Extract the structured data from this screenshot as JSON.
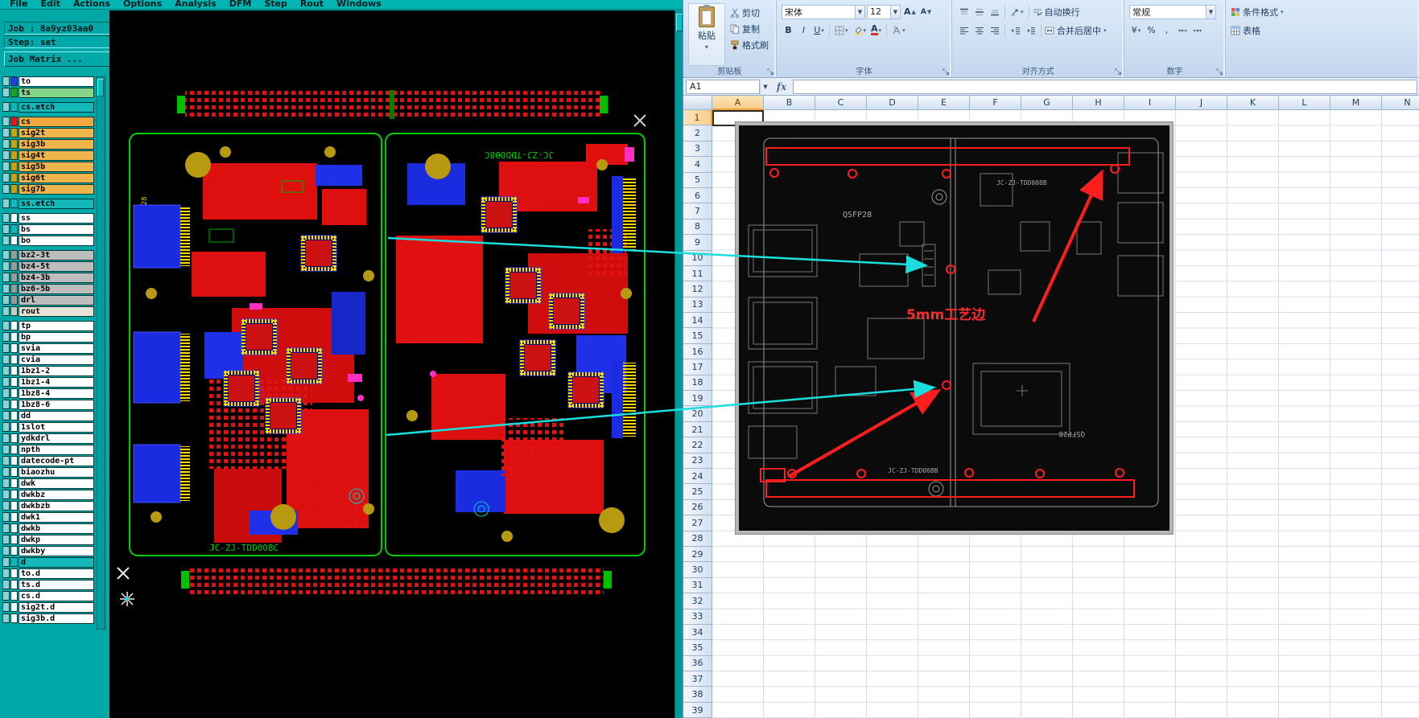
{
  "left_app": {
    "menu": [
      "File",
      "Edit",
      "Actions",
      "Options",
      "Analysis",
      "DFM",
      "Step",
      "Rout",
      "Windows"
    ],
    "job_label": "Job : 8a9yz03aa0",
    "step_label": "Step: set",
    "matrix_button": "Job Matrix ...",
    "board_label_left": "JC-ZJ-TDD008C",
    "board_label_right": "JC-ZJ-TDD008C",
    "conn_label": "QSFP28",
    "layers": [
      {
        "name": "to",
        "sw": "#2a3bd8",
        "bg": "#ffffff",
        "fg": "#000000"
      },
      {
        "name": "ts",
        "sw": "#1f9e1f",
        "bg": "#84d68a",
        "fg": "#000000",
        "gap": true
      },
      {
        "name": "cs.etch",
        "sw": "#14b8b8",
        "bg": "#14b8b8",
        "fg": "#000000",
        "gap": true
      },
      {
        "name": "cs",
        "sw": "#e01818",
        "bg": "#f0a83c",
        "fg": "#000000"
      },
      {
        "name": "sig2t",
        "sw": "#c8a018",
        "bg": "#f0b44c",
        "fg": "#000000"
      },
      {
        "name": "sig3b",
        "sw": "#c8a018",
        "bg": "#f0b44c",
        "fg": "#000000"
      },
      {
        "name": "sig4t",
        "sw": "#c8a018",
        "bg": "#f0b44c",
        "fg": "#000000"
      },
      {
        "name": "sig5b",
        "sw": "#c8a018",
        "bg": "#f0b44c",
        "fg": "#000000"
      },
      {
        "name": "sig6t",
        "sw": "#c8a018",
        "bg": "#f0b44c",
        "fg": "#000000"
      },
      {
        "name": "sig7b",
        "sw": "#c8a018",
        "bg": "#f0b44c",
        "fg": "#000000",
        "gap": true
      },
      {
        "name": "ss.etch",
        "sw": "#14b8b8",
        "bg": "#14b8b8",
        "fg": "#000000",
        "gap": true
      },
      {
        "name": "ss",
        "sw": "#f8f8f8",
        "bg": "#ffffff",
        "fg": "#000000"
      },
      {
        "name": "bs",
        "sw": "#14b8b8",
        "bg": "#ffffff",
        "fg": "#000000"
      },
      {
        "name": "bo",
        "sw": "#f8f8f8",
        "bg": "#ffffff",
        "fg": "#000000",
        "gap": true
      },
      {
        "name": "bz2-3t",
        "sw": "#9a9a9a",
        "bg": "#bdbdbd",
        "fg": "#000000"
      },
      {
        "name": "bz4-5t",
        "sw": "#9a9a9a",
        "bg": "#bdbdbd",
        "fg": "#000000"
      },
      {
        "name": "bz4-3b",
        "sw": "#9a9a9a",
        "bg": "#bdbdbd",
        "fg": "#000000"
      },
      {
        "name": "bz6-5b",
        "sw": "#9a9a9a",
        "bg": "#bdbdbd",
        "fg": "#000000"
      },
      {
        "name": "drl",
        "sw": "#9a9a9a",
        "bg": "#bdbdbd",
        "fg": "#000000"
      },
      {
        "name": "rout",
        "sw": "#cfc9ba",
        "bg": "#e6e2d6",
        "fg": "#000000",
        "gap": true
      },
      {
        "name": "tp",
        "sw": "#f8f8f8",
        "bg": "#ffffff",
        "fg": "#000000"
      },
      {
        "name": "bp",
        "sw": "#f8f8f8",
        "bg": "#ffffff",
        "fg": "#000000"
      },
      {
        "name": "svia",
        "sw": "#f8f8f8",
        "bg": "#ffffff",
        "fg": "#000000"
      },
      {
        "name": "cvia",
        "sw": "#f8f8f8",
        "bg": "#ffffff",
        "fg": "#000000"
      },
      {
        "name": "1bz1-2",
        "sw": "#f8f8f8",
        "bg": "#ffffff",
        "fg": "#000000"
      },
      {
        "name": "1bz1-4",
        "sw": "#f8f8f8",
        "bg": "#ffffff",
        "fg": "#000000"
      },
      {
        "name": "1bz8-4",
        "sw": "#f8f8f8",
        "bg": "#ffffff",
        "fg": "#000000"
      },
      {
        "name": "1bz8-6",
        "sw": "#f8f8f8",
        "bg": "#ffffff",
        "fg": "#000000"
      },
      {
        "name": "dd",
        "sw": "#f8f8f8",
        "bg": "#ffffff",
        "fg": "#000000"
      },
      {
        "name": "1slot",
        "sw": "#f8f8f8",
        "bg": "#ffffff",
        "fg": "#000000"
      },
      {
        "name": "ydkdrl",
        "sw": "#f8f8f8",
        "bg": "#ffffff",
        "fg": "#000000"
      },
      {
        "name": "npth",
        "sw": "#f8f8f8",
        "bg": "#ffffff",
        "fg": "#000000"
      },
      {
        "name": "datecode-pt",
        "sw": "#f8f8f8",
        "bg": "#ffffff",
        "fg": "#000000"
      },
      {
        "name": "biaozhu",
        "sw": "#f8f8f8",
        "bg": "#ffffff",
        "fg": "#000000"
      },
      {
        "name": "dwk",
        "sw": "#f8f8f8",
        "bg": "#ffffff",
        "fg": "#000000"
      },
      {
        "name": "dwkbz",
        "sw": "#f8f8f8",
        "bg": "#ffffff",
        "fg": "#000000"
      },
      {
        "name": "dwkbzb",
        "sw": "#f8f8f8",
        "bg": "#ffffff",
        "fg": "#000000"
      },
      {
        "name": "dwk1",
        "sw": "#f8f8f8",
        "bg": "#ffffff",
        "fg": "#000000"
      },
      {
        "name": "dwkb",
        "sw": "#f8f8f8",
        "bg": "#ffffff",
        "fg": "#000000"
      },
      {
        "name": "dwkp",
        "sw": "#f8f8f8",
        "bg": "#ffffff",
        "fg": "#000000"
      },
      {
        "name": "dwkby",
        "sw": "#f8f8f8",
        "bg": "#ffffff",
        "fg": "#000000"
      },
      {
        "name": "d",
        "sw": "#14b8b8",
        "bg": "#14b8b8",
        "fg": "#000000"
      },
      {
        "name": "to.d",
        "sw": "#f8f8f8",
        "bg": "#ffffff",
        "fg": "#000000"
      },
      {
        "name": "ts.d",
        "sw": "#f8f8f8",
        "bg": "#ffffff",
        "fg": "#000000"
      },
      {
        "name": "cs.d",
        "sw": "#f8f8f8",
        "bg": "#ffffff",
        "fg": "#000000"
      },
      {
        "name": "sig2t.d",
        "sw": "#f8f8f8",
        "bg": "#ffffff",
        "fg": "#000000"
      },
      {
        "name": "sig3b.d",
        "sw": "#f8f8f8",
        "bg": "#ffffff",
        "fg": "#000000"
      }
    ]
  },
  "excel": {
    "ribbon": {
      "clipboard": {
        "label": "剪贴板",
        "paste": "粘贴",
        "cut": "剪切",
        "copy": "复制",
        "format_painter": "格式刷"
      },
      "font": {
        "label": "字体",
        "font_name": "宋体",
        "font_size": "12"
      },
      "alignment": {
        "label": "对齐方式",
        "wrap_text": "自动换行",
        "merge_center": "合并后居中"
      },
      "number": {
        "label": "数字",
        "format": "常规"
      },
      "styles": {
        "conditional": "条件格式",
        "table_style": "表格"
      }
    },
    "name_box": "A1",
    "fx": "fx",
    "selected_column": "A",
    "selected_row": "1",
    "columns": [
      "A",
      "B",
      "C",
      "D",
      "E",
      "F",
      "G",
      "H",
      "I",
      "J",
      "K",
      "L",
      "M",
      "N"
    ],
    "rows": [
      "1",
      "2",
      "3",
      "4",
      "5",
      "6",
      "7",
      "8",
      "9",
      "10",
      "11",
      "12",
      "13",
      "14",
      "15",
      "16",
      "17",
      "18",
      "19",
      "20",
      "21",
      "22",
      "23",
      "24",
      "25",
      "26",
      "27",
      "28",
      "29",
      "30",
      "31",
      "32",
      "33",
      "34",
      "35",
      "36",
      "37",
      "38",
      "39"
    ],
    "image": {
      "annotation": "5mm工艺边",
      "label_qsfp_top": "QSFP28",
      "label_qsfp_bottom": "QSFP28",
      "label_board_top": "JC-ZJ-TDD008B",
      "label_board_bottom": "JC-ZJ-TDD008B"
    }
  },
  "overlay": {
    "arrow_color": "#1adede"
  }
}
